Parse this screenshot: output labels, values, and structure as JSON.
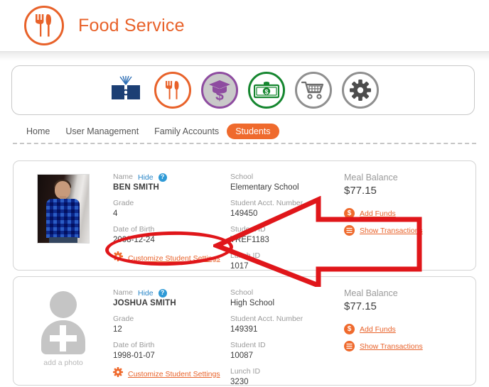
{
  "header": {
    "title": "Food Service",
    "logo_icon": "fork-knife-circle-icon",
    "brand_color": "#e8622a"
  },
  "toolbar": {
    "icons": [
      {
        "name": "book-icon",
        "label": "Curriculum",
        "color": "#1c3f74"
      },
      {
        "name": "food-service-icon",
        "label": "Food Service",
        "color": "#e8622a"
      },
      {
        "name": "graduation-fee-icon",
        "label": "Student Fees",
        "color": "#8e4ca0"
      },
      {
        "name": "money-bill-icon",
        "label": "Payments",
        "color": "#15862f"
      },
      {
        "name": "shopping-cart-icon",
        "label": "Store",
        "color": "#8f8f8f"
      },
      {
        "name": "gear-icon",
        "label": "Settings",
        "color": "#6e6e6e"
      }
    ]
  },
  "nav": {
    "items": [
      {
        "label": "Home",
        "active": false
      },
      {
        "label": "User Management",
        "active": false
      },
      {
        "label": "Family Accounts",
        "active": false
      },
      {
        "label": "Students",
        "active": true
      }
    ],
    "active_color": "#ef6a2d"
  },
  "labels": {
    "name": "Name",
    "hide": "Hide",
    "help": "?",
    "grade": "Grade",
    "date_of_birth": "Date of Birth",
    "school": "School",
    "student_acct_number": "Student Acct. Number",
    "student_id": "Student ID",
    "lunch_id": "Lunch ID",
    "meal_balance": "Meal Balance",
    "add_funds": "Add Funds",
    "show_transactions": "Show Transactions",
    "customize_student_settings": "Customize Student Settings",
    "add_a_photo": "add a photo"
  },
  "students": [
    {
      "photo": "student-photo",
      "name": "BEN SMITH",
      "grade": "4",
      "date_of_birth": "2008-12-24",
      "school": "Elementary School",
      "student_acct_number": "149450",
      "student_id": "TREF1183",
      "lunch_id": "1017",
      "meal_balance": "$77.15"
    },
    {
      "photo": "add-photo-placeholder",
      "name": "JOSHUA SMITH",
      "grade": "12",
      "date_of_birth": "1998-01-07",
      "school": "High School",
      "student_acct_number": "149391",
      "student_id": "10087",
      "lunch_id": "3230",
      "meal_balance": "$77.15"
    }
  ],
  "annotations": {
    "color": "#e0161a",
    "ellipse_target": "Customize Student Settings",
    "arrow_direction": "left"
  }
}
